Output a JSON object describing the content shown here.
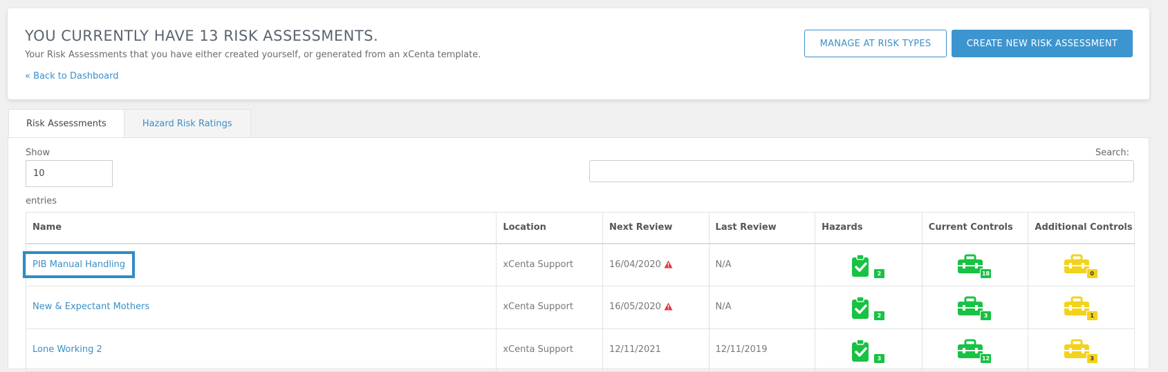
{
  "header": {
    "title": "YOU CURRENTLY HAVE 13 RISK ASSESSMENTS.",
    "subtitle": "Your Risk Assessments that you have either created yourself, or generated from an xCenta template.",
    "back_link": "« Back to Dashboard",
    "manage_button": "MANAGE AT RISK TYPES",
    "create_button": "CREATE NEW RISK ASSESSMENT"
  },
  "tabs": [
    {
      "label": "Risk Assessments",
      "active": true
    },
    {
      "label": "Hazard Risk Ratings",
      "active": false
    }
  ],
  "controls": {
    "show_label": "Show",
    "show_value": "10",
    "entries_label": "entries",
    "search_label": "Search:"
  },
  "table": {
    "columns": [
      "Name",
      "Location",
      "Next Review",
      "Last Review",
      "Hazards",
      "Current Controls",
      "Additional Controls"
    ],
    "rows": [
      {
        "name": "PIB Manual Handling",
        "location": "xCenta Support",
        "next_review": "16/04/2020",
        "overdue": true,
        "last_review": "N/A",
        "hazards": "2",
        "current_controls": "18",
        "additional_controls": "0"
      },
      {
        "name": "New & Expectant Mothers",
        "location": "xCenta Support",
        "next_review": "16/05/2020",
        "overdue": true,
        "last_review": "N/A",
        "hazards": "2",
        "current_controls": "3",
        "additional_controls": "1"
      },
      {
        "name": "Lone Working 2",
        "location": "xCenta Support",
        "next_review": "12/11/2021",
        "overdue": false,
        "last_review": "12/11/2019",
        "hazards": "3",
        "current_controls": "12",
        "additional_controls": "3"
      }
    ]
  },
  "colors": {
    "accent": "#3a8fc7",
    "green": "#18c243",
    "yellow": "#f2d21c",
    "warning": "#e8323c"
  },
  "icons": {
    "hazards": "clipboard-check-icon",
    "current_controls": "toolbox-icon",
    "additional_controls": "toolbox-icon",
    "overdue": "warning-triangle-icon"
  }
}
